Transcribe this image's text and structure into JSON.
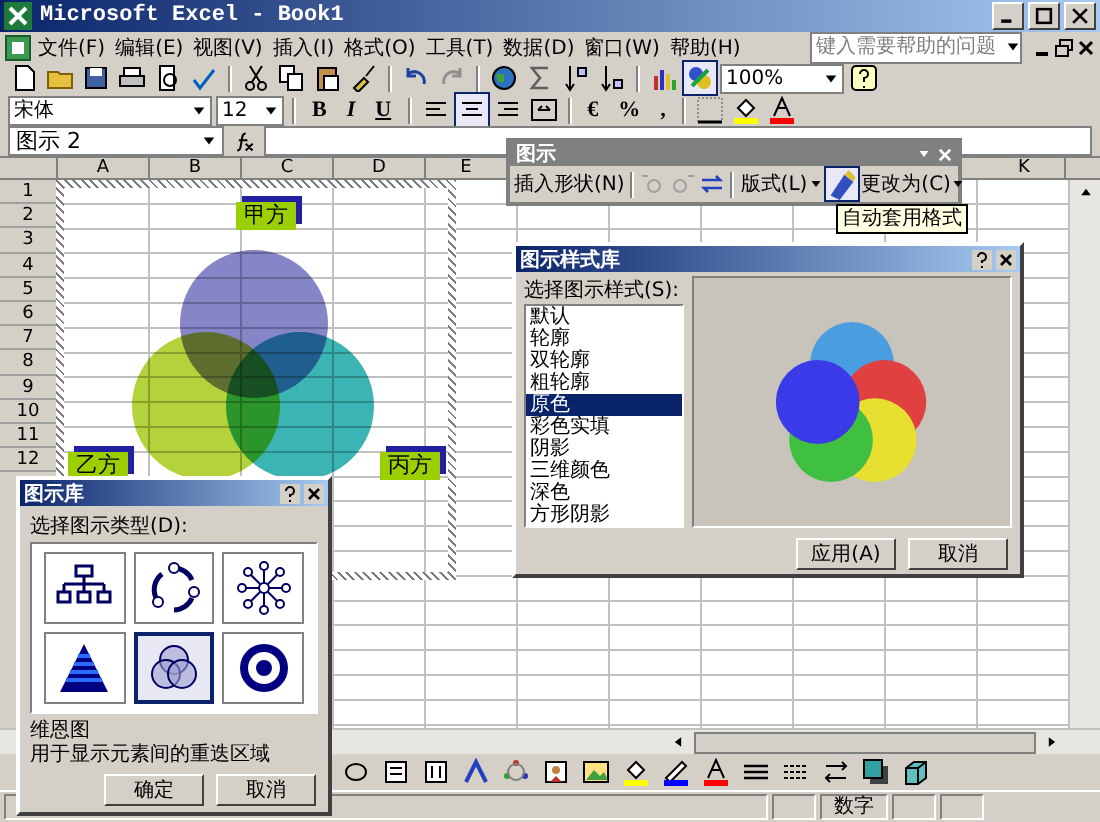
{
  "window": {
    "title": "Microsoft Excel - Book1"
  },
  "menu": {
    "items": [
      "文件(F)",
      "编辑(E)",
      "视图(V)",
      "插入(I)",
      "格式(O)",
      "工具(T)",
      "数据(D)",
      "窗口(W)",
      "帮助(H)"
    ],
    "help_box": {
      "placeholder": "键入需要帮助的问题"
    }
  },
  "standard_toolbar": {
    "diagram_button_pressed": true,
    "zoom": "100%"
  },
  "formatting_toolbar": {
    "font": "宋体",
    "size": "12",
    "style_buttons": [
      {
        "label": "B",
        "selected": false
      },
      {
        "label": "I",
        "selected": false
      },
      {
        "label": "U",
        "selected": false
      }
    ],
    "alignments": [
      {
        "kind": "left",
        "selected": false
      },
      {
        "kind": "center",
        "selected": true
      },
      {
        "kind": "right",
        "selected": false
      },
      {
        "kind": "merge",
        "selected": false
      }
    ],
    "number_buttons": [
      "€",
      "%",
      ","
    ]
  },
  "formula_bar": {
    "name_box": "图示 2"
  },
  "sheet": {
    "columns": [
      "A",
      "B",
      "C",
      "D",
      "E",
      "K"
    ],
    "rows": [
      "1",
      "2",
      "3",
      "4",
      "5",
      "6",
      "7",
      "8",
      "9",
      "10",
      "11",
      "12"
    ],
    "venn": {
      "labels": [
        "甲方",
        "乙方",
        "丙方"
      ],
      "circles": [
        {
          "color": "#8585c8"
        },
        {
          "color": "#b4d23c"
        },
        {
          "color": "#3cb4b4"
        }
      ]
    }
  },
  "diagram_toolbar": {
    "title": "图示",
    "insert_shape": "插入形状(N)",
    "layout": "版式(L)",
    "autoformat_pressed": true,
    "change_to": "更改为(C)",
    "tooltip": "自动套用格式"
  },
  "style_gallery": {
    "title": "图示样式库",
    "list_label": "选择图示样式(S):",
    "styles": [
      {
        "label": "默认",
        "selected": false
      },
      {
        "label": "轮廓",
        "selected": false
      },
      {
        "label": "双轮廓",
        "selected": false
      },
      {
        "label": "粗轮廓",
        "selected": false
      },
      {
        "label": "原色",
        "selected": true
      },
      {
        "label": "彩色实填",
        "selected": false
      },
      {
        "label": "阴影",
        "selected": false
      },
      {
        "label": "三维颜色",
        "selected": false
      },
      {
        "label": "深色",
        "selected": false
      },
      {
        "label": "方形阴影",
        "selected": false
      }
    ],
    "preview_circles": [
      {
        "color": "#4a9ee0"
      },
      {
        "color": "#e04040"
      },
      {
        "color": "#e8e030"
      },
      {
        "color": "#40c040"
      },
      {
        "color": "#3a3ae8"
      }
    ],
    "buttons": [
      "应用(A)",
      "取消"
    ]
  },
  "diagram_gallery": {
    "title": "图示库",
    "type_label": "选择图示类型(D):",
    "types": [
      {
        "kind": "org",
        "selected": false
      },
      {
        "kind": "cycle",
        "selected": false
      },
      {
        "kind": "radial",
        "selected": false
      },
      {
        "kind": "pyramid",
        "selected": false
      },
      {
        "kind": "venn",
        "selected": true
      },
      {
        "kind": "target",
        "selected": false
      }
    ],
    "type_name": "维恩图",
    "description": "用于显示元素间的重迭区域",
    "buttons": [
      "确定",
      "取消"
    ]
  },
  "status_bar": {
    "mode": "数字"
  }
}
